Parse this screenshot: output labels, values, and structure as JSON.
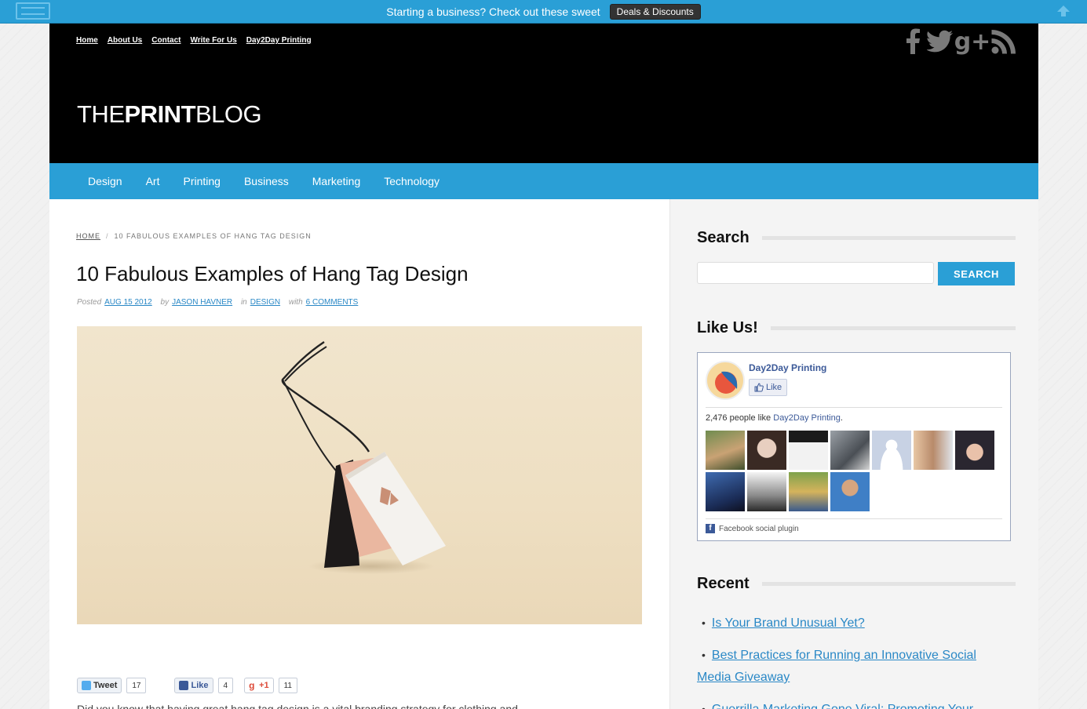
{
  "topbar": {
    "text": "Starting a business?  Check out these sweet",
    "button": "Deals & Discounts"
  },
  "header": {
    "nav": [
      "Home",
      "About Us",
      "Contact",
      "Write For Us",
      "Day2Day Printing"
    ],
    "logo_light_1": "THE",
    "logo_bold": "PRINT",
    "logo_light_2": "BLOG",
    "social_icons": [
      "facebook-icon",
      "twitter-icon",
      "google-plus-icon",
      "rss-icon"
    ]
  },
  "mainnav": [
    "Design",
    "Art",
    "Printing",
    "Business",
    "Marketing",
    "Technology"
  ],
  "post": {
    "breadcrumb_home": "HOME",
    "breadcrumb_sep": "/",
    "breadcrumb_current": "10 FABULOUS EXAMPLES OF HANG TAG DESIGN",
    "title": "10 Fabulous Examples of Hang Tag Design",
    "meta": {
      "posted_label": "Posted",
      "date": "AUG 15 2012",
      "by_label": "by",
      "author": "JASON HAVNER",
      "in_label": "in",
      "category": "DESIGN",
      "with_label": "with",
      "comments": "6 COMMENTS"
    },
    "image_alt": "hang tag photo",
    "share": {
      "tweet_label": "Tweet",
      "tweet_count": "17",
      "like_label": "Like",
      "like_count": "4",
      "gplus_label": "+1",
      "gplus_count": "11"
    },
    "excerpt": "Did you know that having great hang tag design is a vital branding strategy for clothing and"
  },
  "sidebar": {
    "search_title": "Search",
    "search_button": "SEARCH",
    "like_title": "Like Us!",
    "fb": {
      "page_name": "Day2Day Printing",
      "like_button": "Like",
      "count_text": "2,476 people like",
      "count_link": "Day2Day Printing",
      "count_end": ".",
      "plugin_label": "Facebook social plugin"
    },
    "recent_title": "Recent",
    "recent": [
      "Is Your Brand Unusual Yet?",
      "Best Practices for Running an Innovative Social Media Giveaway",
      "Guerrilla Marketing Gone Viral: Promoting Your"
    ]
  },
  "colors": {
    "accent": "#2a9fd6",
    "link": "#2a88c6",
    "header_bg": "#000000",
    "fb_blue": "#3b5998"
  }
}
